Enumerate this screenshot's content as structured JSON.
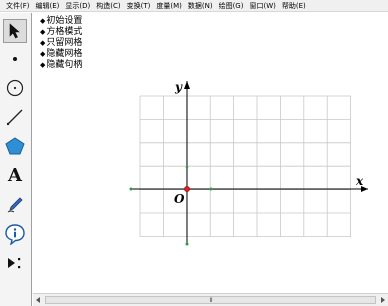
{
  "menubar": {
    "items": [
      "文件(F)",
      "编辑(E)",
      "显示(D)",
      "构造(C)",
      "变换(T)",
      "度量(M)",
      "数据(N)",
      "绘图(G)",
      "窗口(W)",
      "帮助(E)"
    ]
  },
  "toolbox": {
    "tools": [
      {
        "name": "arrow-tool",
        "icon": "arrow-cursor-icon",
        "selected": true
      },
      {
        "name": "point-tool",
        "icon": "point-icon"
      },
      {
        "name": "compass-tool",
        "icon": "circle-icon"
      },
      {
        "name": "straightedge-tool",
        "icon": "line-segment-icon"
      },
      {
        "name": "polygon-tool",
        "icon": "polygon-icon"
      },
      {
        "name": "text-tool",
        "icon": "text-A-icon",
        "label": "A"
      },
      {
        "name": "marker-tool",
        "icon": "marker-pen-icon"
      },
      {
        "name": "information-tool",
        "icon": "information-icon"
      },
      {
        "name": "custom-tool",
        "icon": "custom-tool-icon"
      }
    ]
  },
  "canvas": {
    "commands": [
      "初始设置",
      "方格模式",
      "只留网格",
      "隐藏网格",
      "隐藏句柄"
    ],
    "bullet": "◆",
    "axes": {
      "x_label": "x",
      "y_label": "y",
      "origin_label": "O"
    },
    "colors": {
      "grid": "#c8c8c8",
      "axis": "#000000",
      "origin_point": "#e02020",
      "handle_point": "#2a9d4a"
    }
  },
  "scrollbar": {
    "grip": "III"
  }
}
